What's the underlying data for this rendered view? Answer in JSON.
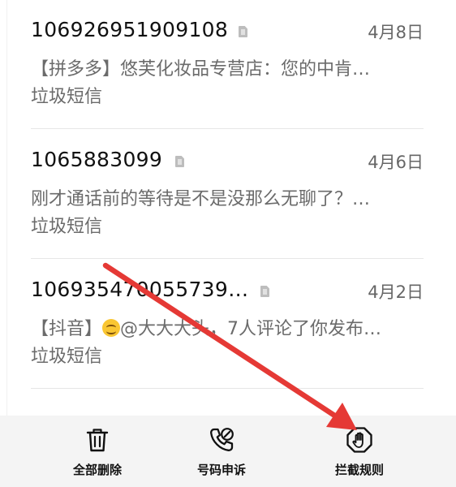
{
  "messages": [
    {
      "sender": "106926951909108",
      "date": "4月8日",
      "preview": "【拼多多】悠芙化妆品专营店：您的中肯…",
      "tag": "垃圾短信"
    },
    {
      "sender": "1065883099",
      "date": "4月6日",
      "preview": "刚才通话前的等待是不是没那么无聊了？…",
      "tag": "垃圾短信"
    },
    {
      "sender": "106935470055739…",
      "date": "4月2日",
      "preview_before": "【抖音】",
      "preview_emoji": "smiling-face-emoji",
      "preview_after": "@大大大头，7人评论了你发布…",
      "tag": "垃圾短信"
    }
  ],
  "toolbar": {
    "delete_all": "全部删除",
    "number_appeal": "号码申诉",
    "block_rules": "拦截规则"
  },
  "icons": {
    "sim": "sim-card-icon",
    "delete": "trash-icon",
    "appeal": "phone-edit-icon",
    "block": "hand-stop-icon"
  },
  "colors": {
    "arrow": "#e53935",
    "toolbar_bg": "#f4f4f4",
    "sender_text": "#111111",
    "secondary_text": "#6b6b6b"
  }
}
